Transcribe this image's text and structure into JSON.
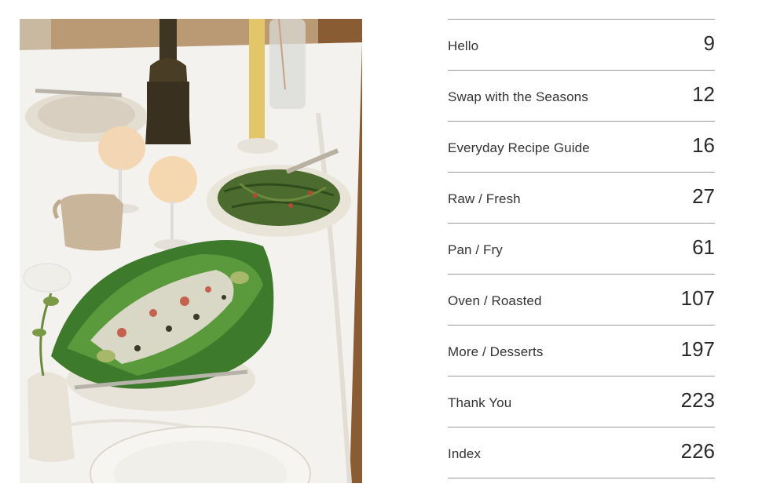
{
  "toc": {
    "entries": [
      {
        "title": "Hello",
        "page": "9"
      },
      {
        "title": "Swap with the Seasons",
        "page": "12"
      },
      {
        "title": "Everyday Recipe Guide",
        "page": "16"
      },
      {
        "title": "Raw / Fresh",
        "page": "27"
      },
      {
        "title": "Pan / Fry",
        "page": "61"
      },
      {
        "title": "Oven / Roasted",
        "page": "107"
      },
      {
        "title": "More / Desserts",
        "page": "197"
      },
      {
        "title": "Thank You",
        "page": "223"
      },
      {
        "title": "Index",
        "page": "226"
      }
    ]
  },
  "photo": {
    "subject": "table-setting-salad-green-beans-wine-candle"
  }
}
